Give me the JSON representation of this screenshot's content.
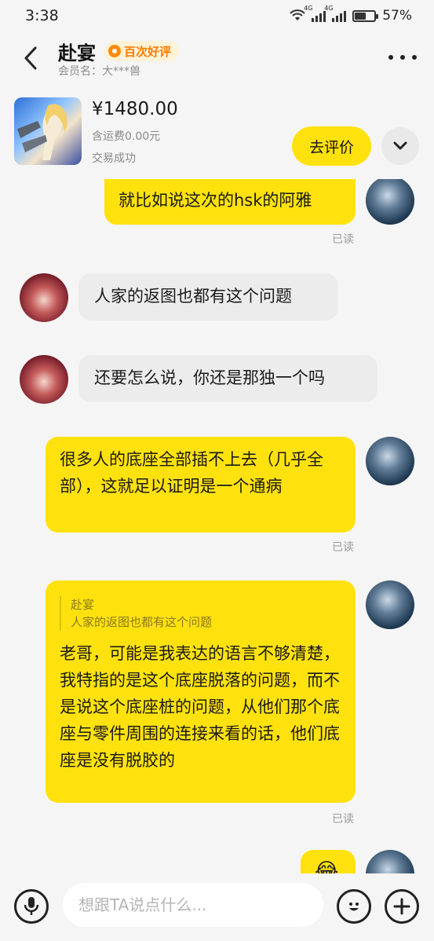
{
  "status_bar": {
    "time": "3:38",
    "signal_label": "4G",
    "battery": "57%",
    "battery_level": 0.57
  },
  "header": {
    "title": "赴宴",
    "badge": "百次好评",
    "member_label": "会员名：大***兽",
    "more_icon": "more-dots-icon",
    "back_icon": "chevron-left-icon"
  },
  "product": {
    "price": "¥1480.00",
    "shipping": "含运费0.00元",
    "status": "交易成功",
    "review_button": "去评价",
    "expand_icon": "chevron-down-icon"
  },
  "messages": [
    {
      "side": "out",
      "text": "就比如说这次的hsk的阿雅",
      "read": "已读"
    },
    {
      "side": "in",
      "text": "人家的返图也都有这个问题"
    },
    {
      "side": "in",
      "text": "还要怎么说，你还是那独一个吗"
    },
    {
      "side": "out",
      "text": "很多人的底座全部插不上去（几乎全部），这就足以证明是一个通病",
      "read": "已读"
    },
    {
      "side": "out",
      "quote_author": "赴宴",
      "quote_text": "人家的返图也都有这个问题",
      "text": "老哥，可能是我表达的语言不够清楚，我特指的是这个底座脱落的问题，而不是说这个底座桩的问题，从他们那个底座与零件周围的连接来看的话，他们底座是没有脱胶的",
      "read": "已读"
    },
    {
      "side": "out",
      "text": "😂"
    }
  ],
  "input_bar": {
    "placeholder": "想跟TA说点什么...",
    "voice_icon": "microphone-icon",
    "emoji_icon": "emoji-icon",
    "add_icon": "plus-icon"
  },
  "colors": {
    "accent_yellow": "#ffe20d",
    "badge_orange": "#ff7a00",
    "incoming_bubble": "#ececec",
    "background": "#f5f5f5"
  }
}
